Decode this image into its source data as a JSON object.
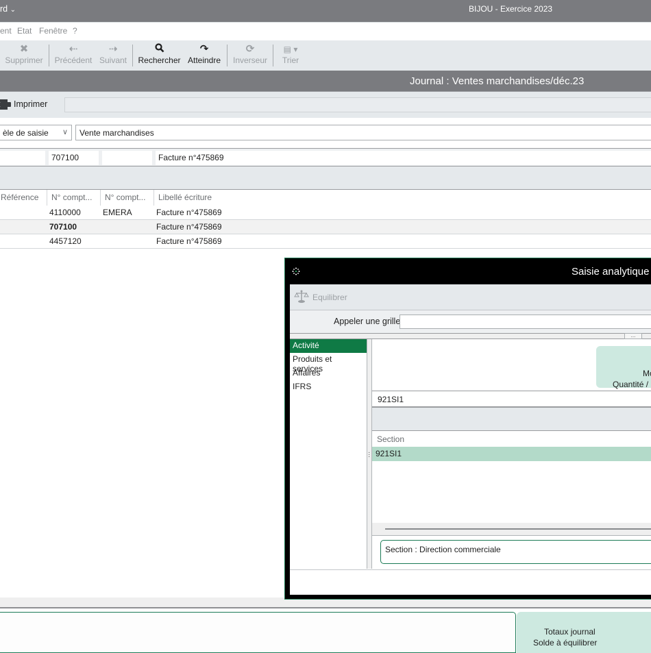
{
  "window": {
    "left_fragment": "rd",
    "title": "BIJOU - Exercice 2023"
  },
  "menu": {
    "items": [
      "ent",
      "Etat",
      "Fenêtre",
      "?"
    ]
  },
  "toolbar": {
    "buttons": [
      {
        "label": "Supprimer",
        "icon": "close-x-icon",
        "enabled": false
      },
      {
        "label": "Précédent",
        "icon": "arrow-left-icon",
        "enabled": false
      },
      {
        "label": "Suivant",
        "icon": "arrow-right-icon",
        "enabled": false
      },
      {
        "label": "Rechercher",
        "icon": "search-icon",
        "enabled": true
      },
      {
        "label": "Atteindre",
        "icon": "redo-arrow-icon",
        "enabled": true
      },
      {
        "label": "Inverseur",
        "icon": "refresh-icon",
        "enabled": false
      },
      {
        "label": "Trier",
        "icon": "sort-list-icon",
        "enabled": false
      }
    ]
  },
  "journal": {
    "title": "Journal : Ventes marchandises/déc.23"
  },
  "print": {
    "label": "Imprimer",
    "field_value": ""
  },
  "saisie": {
    "model_combo": "èle de saisie",
    "model_value": "Vente marchandises"
  },
  "entry": {
    "field1": "",
    "account": "707100",
    "aux_account": "",
    "label": "Facture n°475869"
  },
  "table": {
    "columns": [
      "Référence",
      "N° compt...",
      "N° compt...",
      "Libellé écriture"
    ],
    "rows": [
      {
        "reference": "",
        "account": "4110000",
        "aux": "EMERA",
        "label": "Facture n°475869",
        "bold": false
      },
      {
        "reference": "",
        "account": "707100",
        "aux": "",
        "label": "Facture n°475869",
        "bold": true
      },
      {
        "reference": "",
        "account": "4457120",
        "aux": "",
        "label": "Facture n°475869",
        "bold": false
      }
    ]
  },
  "totals": {
    "line1": "Totaux journal",
    "line2": "Solde à équilibrer"
  },
  "dialog": {
    "title": "Saisie analytique :",
    "equilibrer_label": "Equilibrer",
    "grille_label": "Appeler une grille",
    "grille_value": "",
    "dots_label": "...",
    "axes": [
      {
        "label": "Activité",
        "selected": true
      },
      {
        "label": "Produits et services",
        "selected": false
      },
      {
        "label": "Affaires",
        "selected": false
      },
      {
        "label": "IFRS",
        "selected": false
      }
    ],
    "montant_line1": "Mo",
    "montant_line2": "Quantité /",
    "section_value": "921SI1",
    "section_header": "Section",
    "section_rows": [
      "921SI1"
    ],
    "description": "Section : Direction commerciale"
  },
  "colors": {
    "accent_green": "#0f7a45",
    "selected_row": "#b3dac9",
    "totals_bg": "#cde9e0",
    "titlebar": "#7a7b7f"
  }
}
